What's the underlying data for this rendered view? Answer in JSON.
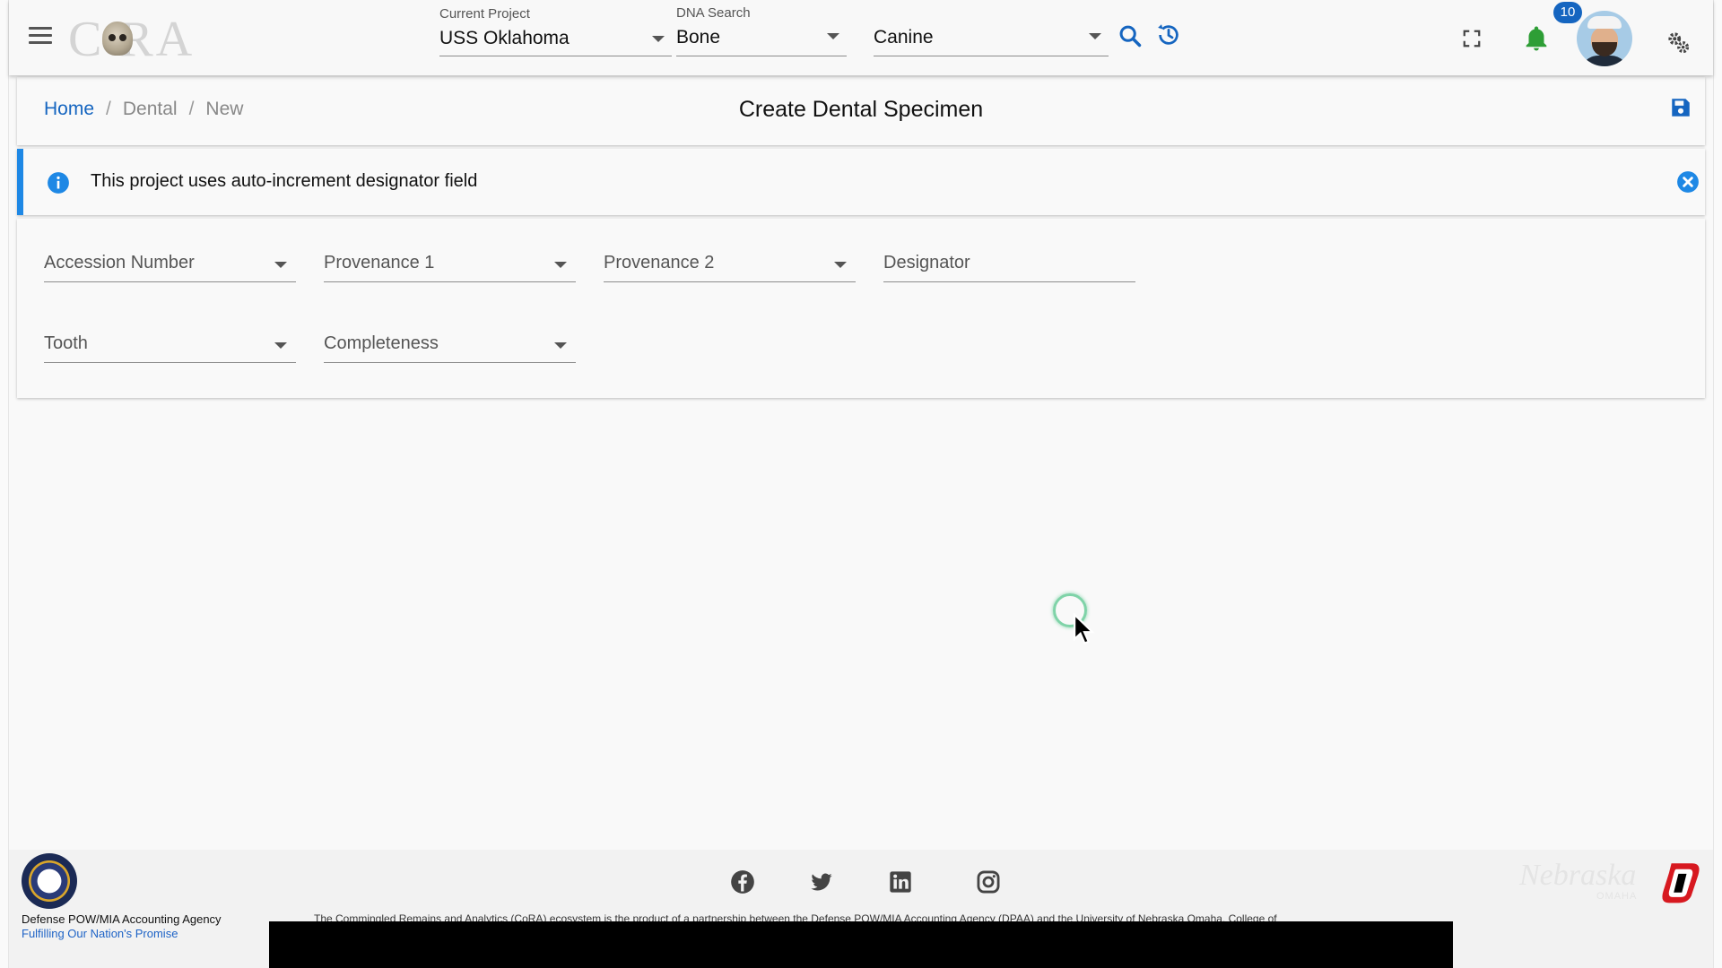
{
  "app": {
    "logo_text": "C RA"
  },
  "header": {
    "project": {
      "label": "Current Project",
      "value": "USS Oklahoma"
    },
    "dna": {
      "label": "DNA Search",
      "value": "Bone"
    },
    "element": {
      "value": "Canine"
    },
    "notification_count": "10",
    "colors": {
      "accent": "#1565c0",
      "bell": "#2e9e36"
    }
  },
  "breadcrumb": {
    "home": "Home",
    "section": "Dental",
    "current": "New",
    "separator": "/"
  },
  "page": {
    "title": "Create Dental Specimen"
  },
  "alert": {
    "text": "This project uses auto-increment designator field"
  },
  "form": {
    "fields": [
      {
        "label": "Accession Number",
        "type": "select"
      },
      {
        "label": "Provenance 1",
        "type": "select"
      },
      {
        "label": "Provenance 2",
        "type": "select"
      },
      {
        "label": "Designator",
        "type": "text"
      },
      {
        "label": "Tooth",
        "type": "select"
      },
      {
        "label": "Completeness",
        "type": "select"
      }
    ]
  },
  "footer": {
    "agency": "Defense POW/MIA Accounting Agency",
    "tagline": "Fulfilling Our Nation's Promise",
    "disclaimer": "The Commingled Remains and Analytics (CoRA) ecosystem is the product of a partnership between the Defense POW/MIA Accounting Agency (DPAA) and the University of Nebraska Omaha, College of",
    "nebraska": "Nebraska",
    "nebraska_sub": "OMAHA",
    "social_icons": [
      "facebook-icon",
      "twitter-icon",
      "linkedin-icon",
      "instagram-icon"
    ]
  }
}
